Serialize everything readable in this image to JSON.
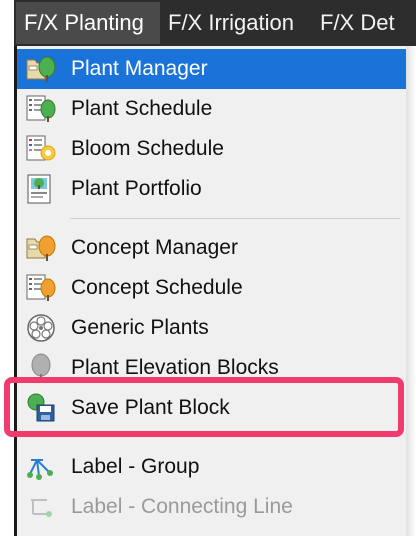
{
  "menubar": {
    "items": [
      "F/X Planting",
      "F/X Irrigation",
      "F/X Det"
    ]
  },
  "menu": {
    "items": [
      {
        "label": "Plant Manager",
        "icon": "folder-tree-icon",
        "state": "selected"
      },
      {
        "label": "Plant Schedule",
        "icon": "schedule-tree-icon",
        "state": "normal"
      },
      {
        "label": "Bloom Schedule",
        "icon": "schedule-flower-icon",
        "state": "normal"
      },
      {
        "label": "Plant Portfolio",
        "icon": "portfolio-icon",
        "state": "normal"
      },
      {
        "label": "Concept Manager",
        "icon": "folder-concept-tree-icon",
        "state": "normal"
      },
      {
        "label": "Concept Schedule",
        "icon": "schedule-concept-tree-icon",
        "state": "normal"
      },
      {
        "label": "Generic Plants",
        "icon": "generic-plant-icon",
        "state": "normal"
      },
      {
        "label": "Plant Elevation Blocks",
        "icon": "elevation-tree-icon",
        "state": "normal"
      },
      {
        "label": "Save Plant Block",
        "icon": "save-plant-block-icon",
        "state": "highlighted"
      },
      {
        "label": "Label - Group",
        "icon": "label-group-icon",
        "state": "normal"
      },
      {
        "label": "Label - Connecting Line",
        "icon": "label-connecting-line-icon",
        "state": "faded"
      }
    ]
  },
  "colors": {
    "menubar": "#2d2d2d",
    "selected": "#1a73d9",
    "highlight_border": "#f03b6e",
    "dropdown_bg": "#f0f0f0"
  }
}
